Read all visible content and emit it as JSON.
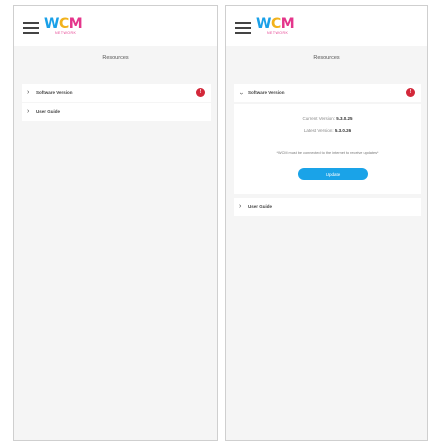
{
  "app": {
    "logo_text": "WCM",
    "logo_subtitle": "NETWORK"
  },
  "left_screen": {
    "section_title": "Resources",
    "items": [
      {
        "label": "Software Version",
        "badge": "!"
      },
      {
        "label": "User Guide"
      }
    ]
  },
  "right_screen": {
    "section_title": "Resources",
    "software": {
      "label": "Software Version",
      "badge": "!",
      "current_label": "Current Version:",
      "current_value": "5.3.0.25",
      "latest_label": "Latest Version:",
      "latest_value": "5.3.0.26",
      "note": "*WCM must be connected to the internet to receive updates*",
      "update_button": "Update"
    },
    "user_guide_label": "User Guide"
  },
  "colors": {
    "accent": "#1aa3e8",
    "badge": "#d3283a",
    "logo_blue": "#1aa0e8",
    "logo_yellow": "#f2b21c",
    "logo_pink": "#e4368b"
  }
}
